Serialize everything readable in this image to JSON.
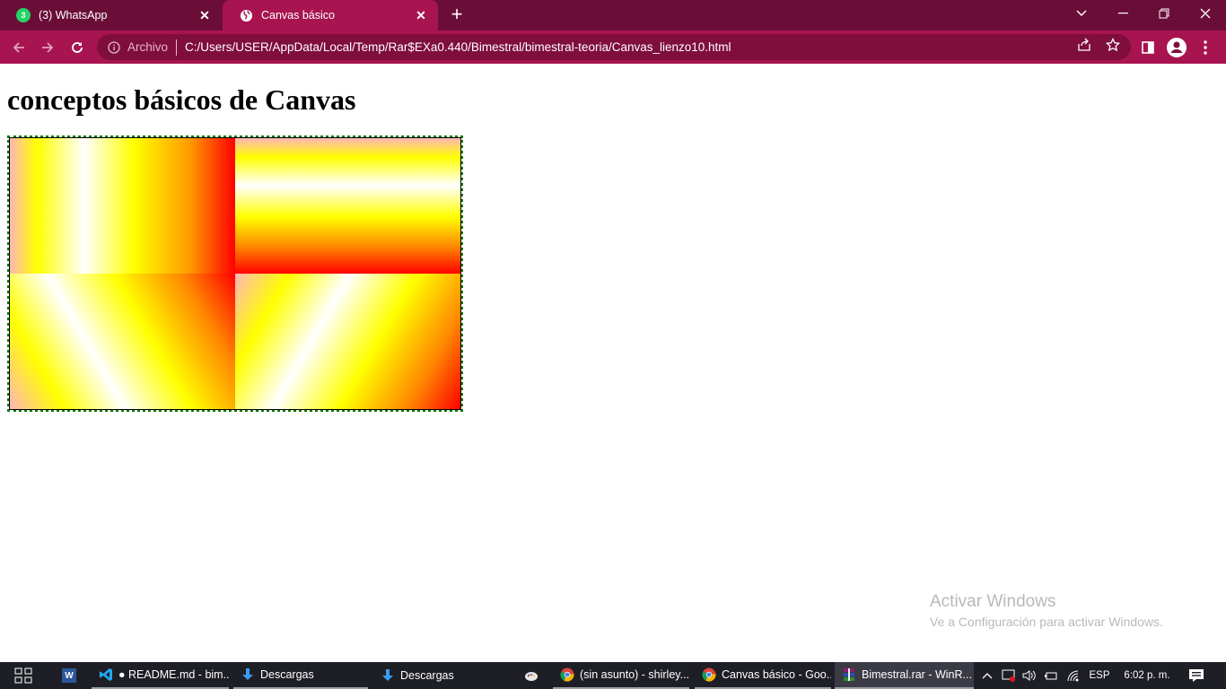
{
  "browser": {
    "tabs": [
      {
        "title": "(3) WhatsApp",
        "badge": "3",
        "active": false
      },
      {
        "title": "Canvas básico",
        "active": true
      }
    ],
    "omnibox": {
      "scheme_label": "Archivo",
      "url": "C:/Users/USER/AppData/Local/Temp/Rar$EXa0.440/Bimestral/bimestral-teoria/Canvas_lienzo10.html"
    },
    "colors": {
      "tabstrip": "#6a0e38",
      "toolbar": "#a8144f",
      "omnibox": "#7f0e3c"
    }
  },
  "page": {
    "heading": "conceptos básicos de Canvas",
    "canvas": {
      "border": "dotted green",
      "quadrants": [
        {
          "gradient": "horizontal",
          "colors": [
            "pink",
            "yellow",
            "white",
            "yellow",
            "orange",
            "red"
          ]
        },
        {
          "gradient": "vertical",
          "colors": [
            "pink",
            "yellow",
            "white",
            "yellow",
            "orange",
            "red"
          ]
        },
        {
          "gradient": "diagonal",
          "colors": [
            "pink",
            "yellow",
            "white",
            "yellow",
            "orange",
            "red"
          ]
        },
        {
          "gradient": "diagonal",
          "colors": [
            "pink",
            "yellow",
            "white",
            "yellow",
            "orange",
            "red"
          ]
        }
      ]
    }
  },
  "watermark": {
    "line1": "Activar Windows",
    "line2": "Ve a Configuración para activar Windows."
  },
  "taskbar": {
    "items": [
      {
        "label": "",
        "icon": "word-icon"
      },
      {
        "label": "● README.md - bim...",
        "icon": "vscode-icon"
      },
      {
        "label": "Descargas",
        "icon": "download-icon"
      },
      {
        "label": "Descargas",
        "icon": "download-icon"
      },
      {
        "label": "",
        "icon": "paint-icon"
      },
      {
        "label": "(sin asunto) - shirley...",
        "icon": "chrome-icon"
      },
      {
        "label": "Canvas básico - Goo...",
        "icon": "chrome-icon"
      },
      {
        "label": "Bimestral.rar - WinR...",
        "icon": "winrar-icon"
      }
    ],
    "tray": {
      "language": "ESP",
      "time": "6:02 p. m."
    }
  }
}
